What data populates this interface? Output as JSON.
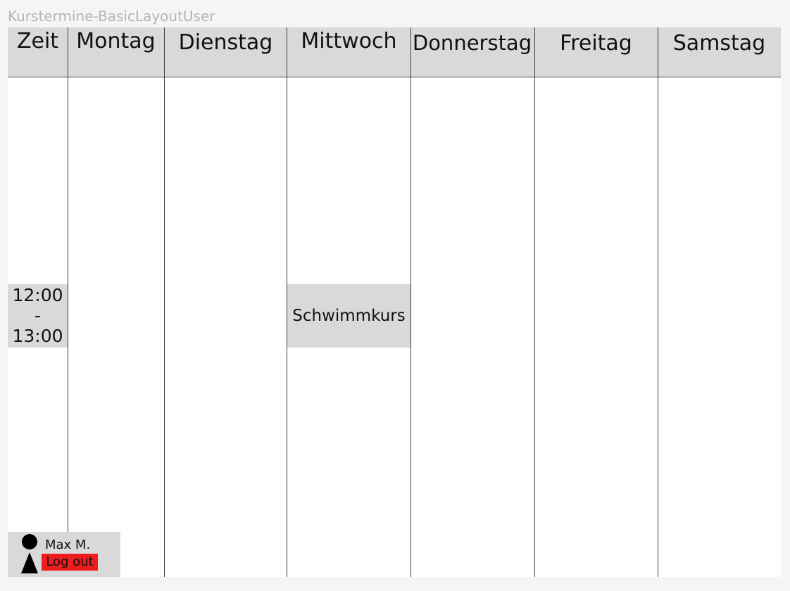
{
  "frame_title": "Kurstermine-BasicLayoutUser",
  "calendar": {
    "time_column_header": "Zeit",
    "days": [
      "Montag",
      "Dienstag",
      "Mittwoch",
      "Donnerstag",
      "Freitag",
      "Samstag"
    ],
    "time_slot": {
      "start": "12:00",
      "separator": "-",
      "end": "13:00"
    },
    "events": [
      {
        "day": "Mittwoch",
        "title": "Schwimmkurs"
      }
    ]
  },
  "user": {
    "name": "Max M.",
    "logout_label": "Log out",
    "avatar_icon": "user-icon"
  },
  "colors": {
    "header_bg": "#d9d9d9",
    "logout_bg": "#ee1c1c"
  }
}
